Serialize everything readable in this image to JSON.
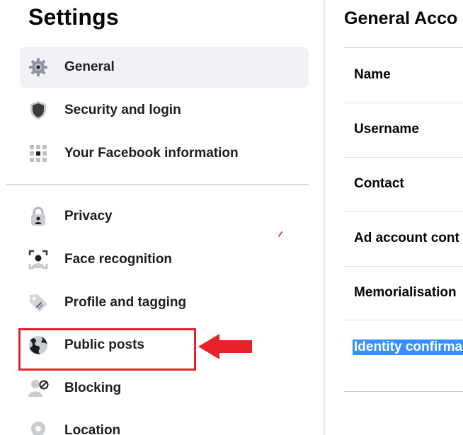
{
  "sidebar": {
    "title": "Settings",
    "items": [
      {
        "label": "General",
        "icon": "gear-icon",
        "active": true
      },
      {
        "label": "Security and login",
        "icon": "shield-icon",
        "active": false
      },
      {
        "label": "Your Facebook information",
        "icon": "facebook-grid-icon",
        "active": false
      },
      {
        "label": "Privacy",
        "icon": "lock-icon",
        "active": false
      },
      {
        "label": "Face recognition",
        "icon": "face-scan-icon",
        "active": false
      },
      {
        "label": "Profile and tagging",
        "icon": "tag-icon",
        "active": false
      },
      {
        "label": "Public posts",
        "icon": "globe-icon",
        "active": false
      },
      {
        "label": "Blocking",
        "icon": "user-block-icon",
        "active": false
      },
      {
        "label": "Location",
        "icon": "location-pin-icon",
        "active": false
      }
    ]
  },
  "main": {
    "title": "General Acco",
    "rows": [
      {
        "label": "Name"
      },
      {
        "label": "Username"
      },
      {
        "label": "Contact"
      },
      {
        "label": "Ad account cont"
      },
      {
        "label": "Memorialisation"
      },
      {
        "label": "Identity confirma",
        "selected": true
      }
    ]
  },
  "colors": {
    "active_bg": "#f0f2f5",
    "annotation_red": "#e8222a",
    "selection_blue": "#3390ff",
    "icon_grey": "#606770"
  }
}
